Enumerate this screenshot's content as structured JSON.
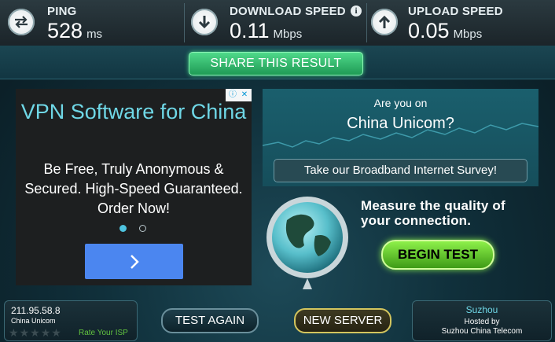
{
  "metrics": {
    "ping": {
      "label": "PING",
      "value": "528",
      "unit": "ms"
    },
    "download": {
      "label": "DOWNLOAD SPEED",
      "value": "0.11",
      "unit": "Mbps"
    },
    "upload": {
      "label": "UPLOAD SPEED",
      "value": "0.05",
      "unit": "Mbps"
    }
  },
  "share_button": "SHARE THIS RESULT",
  "ad": {
    "title": "VPN Software for China",
    "body": "Be Free, Truly Anonymous & Secured. High-Speed Guaranteed. Order Now!"
  },
  "survey": {
    "question_line1": "Are you on",
    "question_line2": "China Unicom?",
    "button": "Take our Broadband Internet Survey!"
  },
  "measure": {
    "line1": "Measure the quality of",
    "line2": "your connection.",
    "button": "BEGIN TEST"
  },
  "client": {
    "ip": "211.95.58.8",
    "isp": "China Unicom",
    "rate_link": "Rate Your ISP",
    "rating_stars": 0
  },
  "buttons": {
    "test_again": "TEST AGAIN",
    "new_server": "NEW SERVER"
  },
  "server": {
    "city": "Suzhou",
    "hosted_label": "Hosted by",
    "host": "Suzhou China Telecom"
  },
  "colors": {
    "accent_green": "#3ed483",
    "begin_green": "#6fcb36",
    "cyan_text": "#6fd7e6",
    "ad_button_blue": "#4b86f0"
  }
}
